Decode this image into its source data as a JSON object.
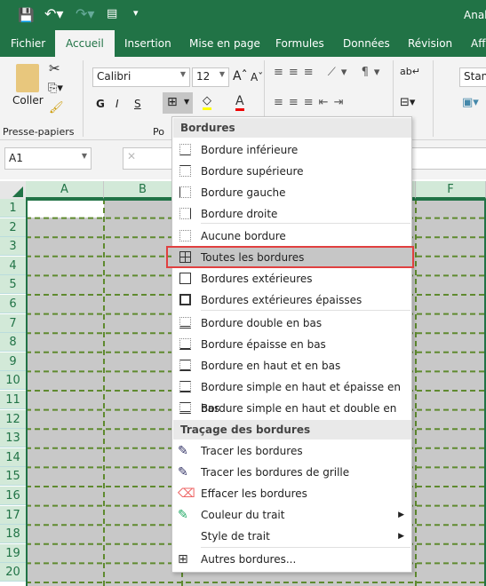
{
  "title": "Anal",
  "tabs": [
    "Fichier",
    "Accueil",
    "Insertion",
    "Mise en page",
    "Formules",
    "Données",
    "Révision",
    "Aff"
  ],
  "ribbon": {
    "paste": "Coller",
    "clipboard_group": "Presse-papiers",
    "font_group": "Po",
    "font_name": "Calibri",
    "font_size": "12",
    "bold": "G",
    "italic": "I",
    "underline": "S",
    "style_box": "Stand"
  },
  "namebox": "A1",
  "columns": [
    "A",
    "B",
    "F"
  ],
  "rows": [
    "1",
    "2",
    "3",
    "4",
    "5",
    "6",
    "7",
    "8",
    "9",
    "10",
    "11",
    "12",
    "13",
    "14",
    "15",
    "16",
    "17",
    "18",
    "19",
    "20"
  ],
  "menu": {
    "header1": "Bordures",
    "header2": "Traçage des bordures",
    "items1": [
      "Bordure inférieure",
      "Bordure supérieure",
      "Bordure gauche",
      "Bordure droite",
      "Aucune bordure",
      "Toutes les bordures",
      "Bordures extérieures",
      "Bordures extérieures épaisses",
      "Bordure double en bas",
      "Bordure épaisse en bas",
      "Bordure en haut et en bas",
      "Bordure simple en haut et épaisse en bas",
      "Bordure simple en haut et double en bas"
    ],
    "items2": [
      "Tracer les bordures",
      "Tracer les bordures de grille",
      "Effacer les bordures",
      "Couleur du trait",
      "Style de trait",
      "Autres bordures..."
    ],
    "highlighted": "Toutes les bordures"
  },
  "colors": {
    "brand": "#217346",
    "highlight_border": "#e04040",
    "border_line": "#5f8a2f"
  }
}
